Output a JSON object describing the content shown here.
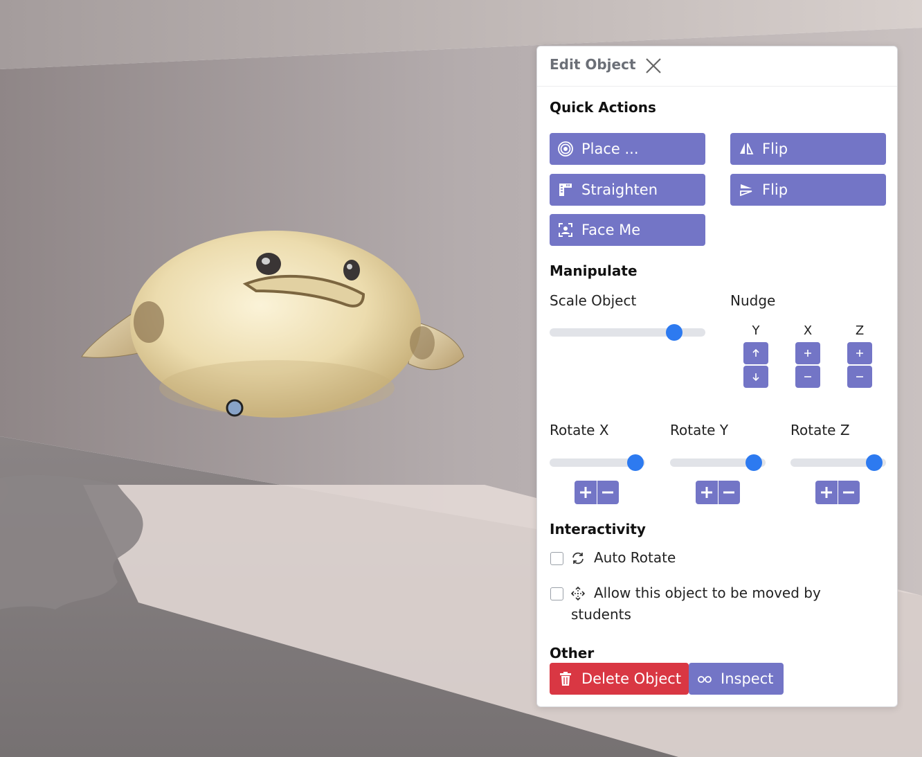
{
  "panel": {
    "title": "Edit Object",
    "close_icon": "close-icon"
  },
  "quick_actions": {
    "heading": "Quick Actions",
    "buttons": [
      {
        "label": "Place ...",
        "icon": "target-icon"
      },
      {
        "label": "Flip",
        "icon": "flip-horizontal-icon"
      },
      {
        "label": "Straighten",
        "icon": "ruler-icon"
      },
      {
        "label": "Flip",
        "icon": "flip-vertical-icon"
      },
      {
        "label": "Face Me",
        "icon": "face-frame-icon"
      }
    ]
  },
  "manipulate": {
    "heading": "Manipulate",
    "scale_label": "Scale Object",
    "scale_value": 0.8,
    "nudge_label": "Nudge",
    "nudge_axes": [
      "Y",
      "X",
      "Z"
    ],
    "rotate": [
      {
        "label": "Rotate X",
        "value": 0.9
      },
      {
        "label": "Rotate Y",
        "value": 0.88
      },
      {
        "label": "Rotate Z",
        "value": 0.88
      }
    ]
  },
  "interactivity": {
    "heading": "Interactivity",
    "auto_rotate": {
      "label": "Auto Rotate",
      "checked": false,
      "icon": "rotate-icon"
    },
    "allow_move": {
      "label_line1": "Allow this object to be moved by",
      "label_line2": "students",
      "checked": false,
      "icon": "move-icon"
    }
  },
  "other": {
    "heading": "Other",
    "delete_label": "Delete Object",
    "inspect_label": "Inspect"
  },
  "colors": {
    "accent": "#7375c6",
    "danger": "#d93743",
    "slider_thumb": "#2d7af0"
  }
}
